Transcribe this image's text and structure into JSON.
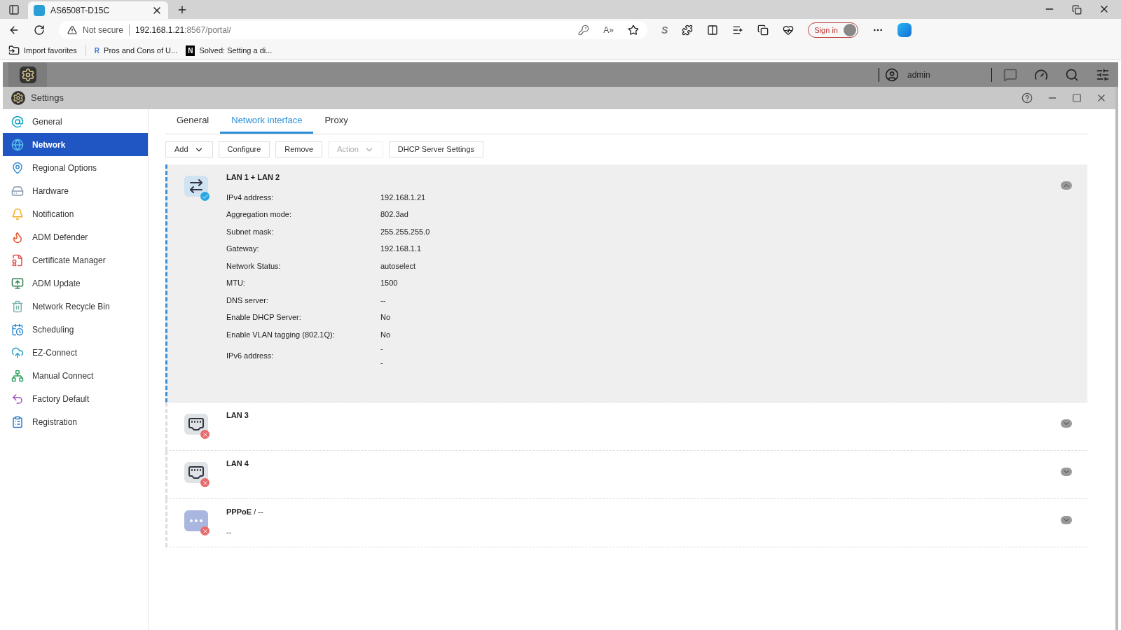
{
  "browser": {
    "tab_title": "AS6508T-D15C",
    "security": "Not secure",
    "url_host": "192.168.1.21",
    "url_rest": ":8567/portal/",
    "bookmarks": [
      "Import favorites",
      "Pros and Cons of U...",
      "Solved: Setting a di..."
    ],
    "bookmark_glyph": "N",
    "bookmark_glyph_2": "R",
    "read_aloud_glyph": "A»",
    "sign_in": "Sign in",
    "s_glyph": "S"
  },
  "topbar": {
    "user": "admin"
  },
  "window": {
    "title": "Settings"
  },
  "sidebar": {
    "items": [
      {
        "label": "General",
        "selected": false
      },
      {
        "label": "Network",
        "selected": true
      },
      {
        "label": "Regional Options",
        "selected": false
      },
      {
        "label": "Hardware",
        "selected": false
      },
      {
        "label": "Notification",
        "selected": false
      },
      {
        "label": "ADM Defender",
        "selected": false
      },
      {
        "label": "Certificate Manager",
        "selected": false
      },
      {
        "label": "ADM Update",
        "selected": false
      },
      {
        "label": "Network Recycle Bin",
        "selected": false
      },
      {
        "label": "Scheduling",
        "selected": false
      },
      {
        "label": "EZ-Connect",
        "selected": false
      },
      {
        "label": "Manual Connect",
        "selected": false
      },
      {
        "label": "Factory Default",
        "selected": false
      },
      {
        "label": "Registration",
        "selected": false
      }
    ]
  },
  "tabs": [
    {
      "label": "General",
      "selected": false
    },
    {
      "label": "Network interface",
      "selected": true
    },
    {
      "label": "Proxy",
      "selected": false
    }
  ],
  "toolbar": [
    {
      "label": "Add",
      "dropdown": true,
      "disabled": false
    },
    {
      "label": "Configure",
      "dropdown": false,
      "disabled": false
    },
    {
      "label": "Remove",
      "dropdown": false,
      "disabled": false
    },
    {
      "label": "Action",
      "dropdown": true,
      "disabled": true
    },
    {
      "label": "DHCP Server Settings",
      "dropdown": false,
      "disabled": false
    }
  ],
  "interfaces": [
    {
      "name": "LAN 1 + LAN 2",
      "kind": "aggregate",
      "connected": true,
      "expanded": true,
      "selected": true,
      "details": [
        {
          "label": "IPv4 address:",
          "values": [
            "192.168.1.21"
          ]
        },
        {
          "label": "Aggregation mode:",
          "values": [
            "802.3ad"
          ]
        },
        {
          "label": "Subnet mask:",
          "values": [
            "255.255.255.0"
          ]
        },
        {
          "label": "Gateway:",
          "values": [
            "192.168.1.1"
          ]
        },
        {
          "label": "Network Status:",
          "values": [
            "autoselect"
          ]
        },
        {
          "label": "MTU:",
          "values": [
            "1500"
          ]
        },
        {
          "label": "DNS server:",
          "values": [
            "--"
          ]
        },
        {
          "label": "Enable DHCP Server:",
          "values": [
            "No"
          ]
        },
        {
          "label": "Enable VLAN tagging (802.1Q):",
          "values": [
            "No"
          ]
        },
        {
          "label": "IPv6 address:",
          "values": [
            "-",
            "-"
          ]
        }
      ]
    },
    {
      "name": "LAN 3",
      "kind": "ethernet",
      "connected": false,
      "expanded": false,
      "selected": false
    },
    {
      "name": "LAN 4",
      "kind": "ethernet",
      "connected": false,
      "expanded": false,
      "selected": false
    },
    {
      "name": "PPPoE",
      "suffix": " / --",
      "subtitle": "--",
      "kind": "pppoe",
      "connected": false,
      "expanded": false,
      "selected": false
    }
  ]
}
